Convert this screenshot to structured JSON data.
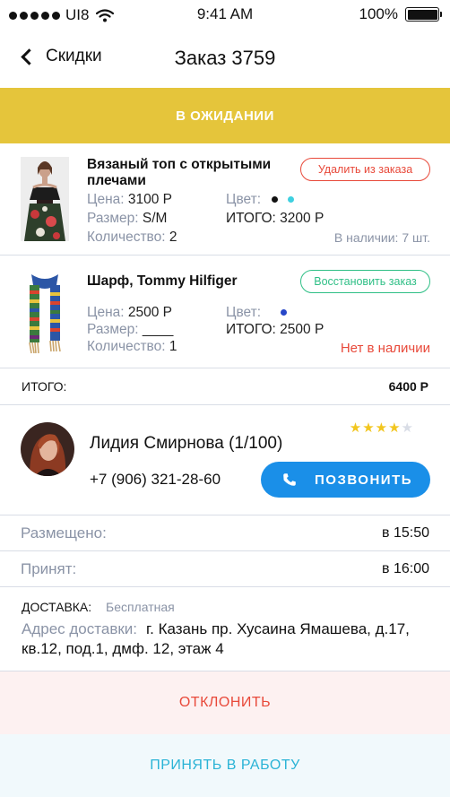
{
  "status_bar": {
    "carrier": "UI8",
    "time": "9:41 AM",
    "battery": "100%",
    "battery_level": 1.0,
    "icons": [
      "signal-dots-icon",
      "wifi-icon",
      "battery-icon"
    ]
  },
  "nav": {
    "back_label": "Скидки",
    "title": "Заказ 3759"
  },
  "order_status": "В ОЖИДАНИИ",
  "items": [
    {
      "name": "Вязаный топ с открытыми плечами",
      "action_label": "Удалить из заказа",
      "price_label": "Цена:",
      "price": "3100 Р",
      "size_label": "Размер:",
      "size": "S/M",
      "qty_label": "Количество:",
      "qty": "2",
      "color_label": "Цвет:",
      "colors": [
        "#111111",
        "#3ed0e0"
      ],
      "total": "ИТОГО: 3200 Р",
      "availability": "В наличии: 7 шт."
    },
    {
      "name": "Шарф, Tommy Hilfiger",
      "action_label": "Восстановить заказ",
      "price_label": "Цена:",
      "price": "2500 Р",
      "size_label": "Размер:",
      "size": "____",
      "qty_label": "Количество:",
      "qty": "1",
      "color_label": "Цвет:",
      "colors": [
        "#2747c8"
      ],
      "total": "ИТОГО: 2500 Р",
      "availability": "Нет в наличии"
    }
  ],
  "total": {
    "label": "ИТОГО:",
    "value": "6400 Р"
  },
  "customer": {
    "name": "Лидия Смирнова  (1/100)",
    "phone": "+7 (906) 321-28-60",
    "rating": 4,
    "rating_max": 5,
    "call_label": "ПОЗВОНИТЬ"
  },
  "times": {
    "placed_label": "Размещено:",
    "placed_value": "в 15:50",
    "accepted_label": "Принят:",
    "accepted_value": "в 16:00"
  },
  "delivery": {
    "label": "ДОСТАВКА:",
    "type": "Бесплатная",
    "address_label": "Адрес доставки:",
    "address": "г. Казань пр. Хусаина Ямашева, д.17, кв.12, под.1, дмф. 12, этаж 4"
  },
  "actions": {
    "decline": "ОТКЛОНИТЬ",
    "accept": "ПРИНЯТЬ В РАБОТУ"
  },
  "colors": {
    "banner": "#e5c53b",
    "danger": "#e8493a",
    "success": "#2fbf86",
    "primary": "#1a8fe8",
    "accept_text": "#2ab3d6",
    "star": "#f2c61f"
  }
}
